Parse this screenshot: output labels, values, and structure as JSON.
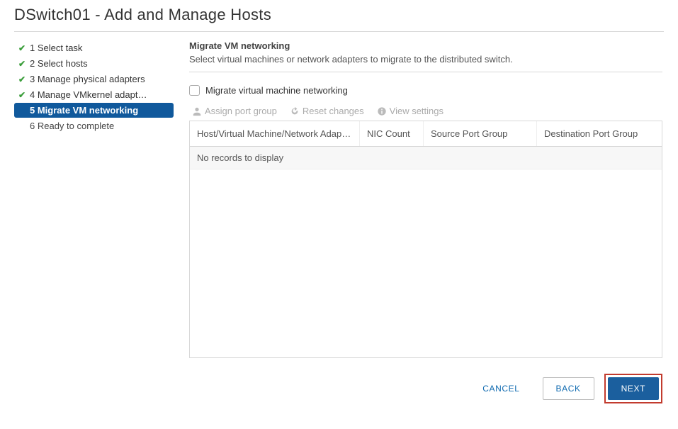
{
  "header": {
    "title": "DSwitch01 - Add and Manage Hosts"
  },
  "sidebar": {
    "steps": [
      {
        "label": "1 Select task",
        "state": "done"
      },
      {
        "label": "2 Select hosts",
        "state": "done"
      },
      {
        "label": "3 Manage physical adapters",
        "state": "done"
      },
      {
        "label": "4 Manage VMkernel adapt…",
        "state": "done"
      },
      {
        "label": "5 Migrate VM networking",
        "state": "active"
      },
      {
        "label": "6 Ready to complete",
        "state": "pending"
      }
    ]
  },
  "main": {
    "title": "Migrate VM networking",
    "description": "Select virtual machines or network adapters to migrate to the distributed switch.",
    "checkbox_label": "Migrate virtual machine networking",
    "checkbox_checked": false,
    "toolbar": {
      "assign": "Assign port group",
      "reset": "Reset changes",
      "view": "View settings"
    },
    "table": {
      "columns": [
        "Host/Virtual Machine/Network Adapter",
        "NIC Count",
        "Source Port Group",
        "Destination Port Group"
      ],
      "rows": [],
      "empty_text": "No records to display"
    }
  },
  "footer": {
    "cancel": "CANCEL",
    "back": "BACK",
    "next": "NEXT"
  }
}
